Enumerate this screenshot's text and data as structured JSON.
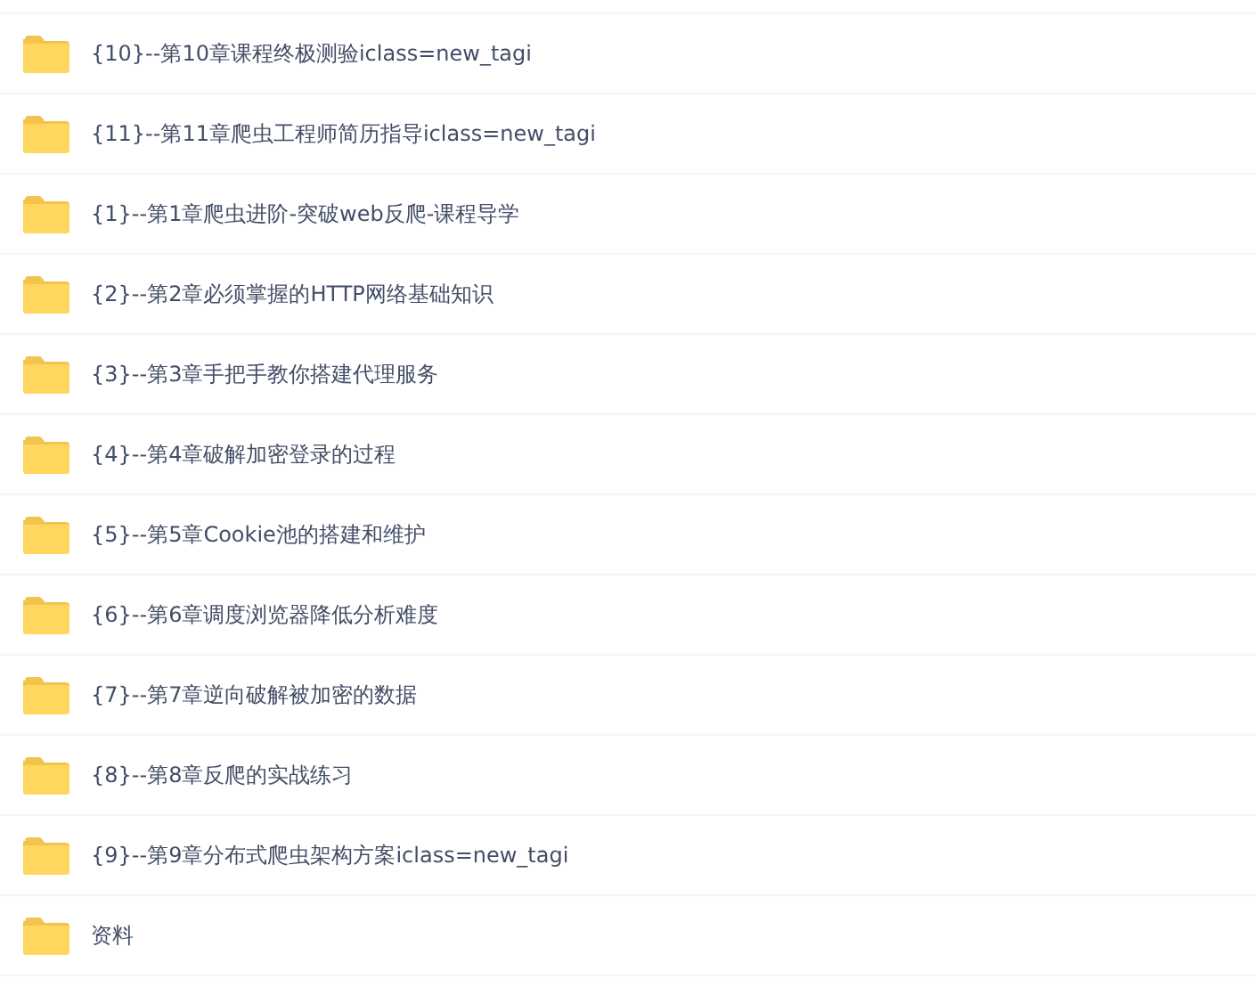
{
  "files": [
    {
      "name": "{10}--第10章课程终极测验iclass=new_tagi"
    },
    {
      "name": "{11}--第11章爬虫工程师简历指导iclass=new_tagi"
    },
    {
      "name": "{1}--第1章爬虫进阶-突破web反爬-课程导学"
    },
    {
      "name": "{2}--第2章必须掌握的HTTP网络基础知识"
    },
    {
      "name": "{3}--第3章手把手教你搭建代理服务"
    },
    {
      "name": "{4}--第4章破解加密登录的过程"
    },
    {
      "name": "{5}--第5章Cookie池的搭建和维护"
    },
    {
      "name": "{6}--第6章调度浏览器降低分析难度"
    },
    {
      "name": "{7}--第7章逆向破解被加密的数据"
    },
    {
      "name": "{8}--第8章反爬的实战练习"
    },
    {
      "name": "{9}--第9章分布式爬虫架构方案iclass=new_tagi"
    },
    {
      "name": "资料"
    }
  ]
}
